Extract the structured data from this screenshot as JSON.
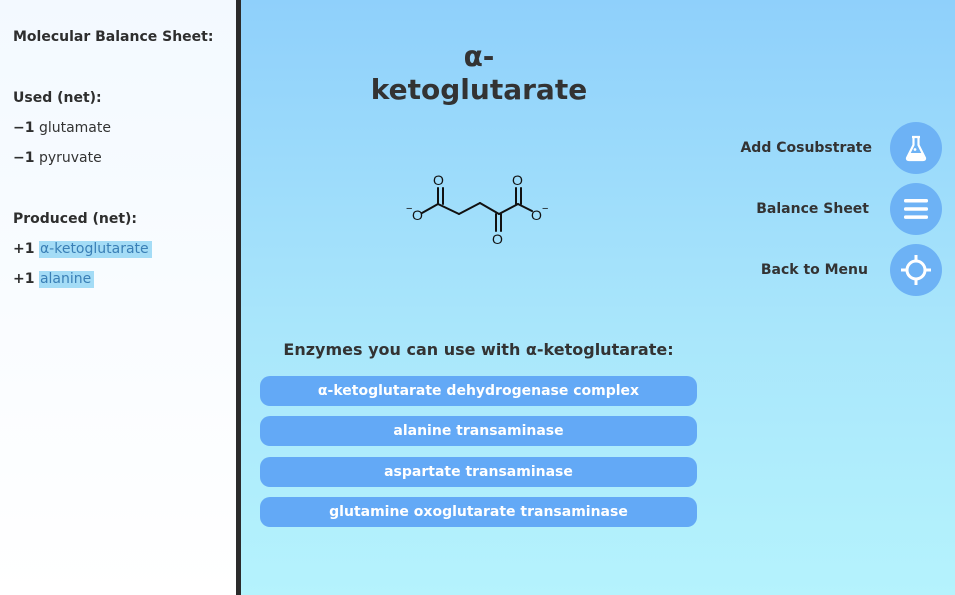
{
  "sidebar": {
    "title": "Molecular Balance Sheet:",
    "used_heading": "Used (net):",
    "used": [
      {
        "delta": "−1",
        "name": "glutamate"
      },
      {
        "delta": "−1",
        "name": "pyruvate"
      }
    ],
    "produced_heading": "Produced (net):",
    "produced": [
      {
        "delta": "+1",
        "name": "α-ketoglutarate"
      },
      {
        "delta": "+1",
        "name": "alanine"
      }
    ]
  },
  "main": {
    "title": "α-ketoglutarate",
    "molecule": {
      "o_top_left": "O",
      "o_top_right": "O",
      "o_bottom": "O",
      "o_left": "O",
      "o_right": "O",
      "neg_charge": "−"
    },
    "actions": [
      {
        "label": "Add Cosubstrate",
        "icon": "flask-icon"
      },
      {
        "label": "Balance Sheet",
        "icon": "menu-icon"
      },
      {
        "label": "Back to Menu",
        "icon": "crosshair-icon"
      }
    ],
    "enzymes_heading": "Enzymes you can use with α-ketoglutarate:",
    "enzymes": [
      "α-ketoglutarate dehydrogenase complex",
      "alanine transaminase",
      "aspartate transaminase",
      "glutamine oxoglutarate transaminase"
    ]
  },
  "colors": {
    "accent_button": "#63a9f6",
    "circle_button": "#6db2f5",
    "highlight": "#a4dcf6",
    "divider": "#2b2b2b"
  }
}
